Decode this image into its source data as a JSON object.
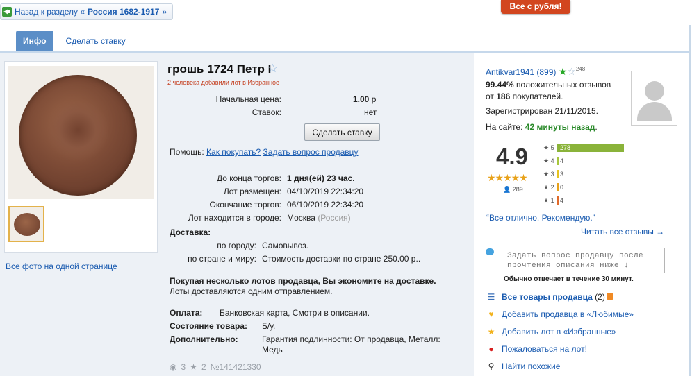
{
  "topbar": {
    "back_prefix": "Назад к разделу «",
    "back_section": "Россия 1682-1917",
    "back_suffix": "»",
    "promo": "Все с рубля!"
  },
  "tabs": [
    {
      "label": "Инфо"
    },
    {
      "label": "Сделать ставку"
    }
  ],
  "gallery": {
    "all_photos_link": "Все фото на одной странице"
  },
  "lot": {
    "title": "грошь 1724 Петр I",
    "fav_note": "2 человека добавили лот в Избранное",
    "start_price_label": "Начальная цена:",
    "start_price_value": "1.00",
    "currency": "р",
    "bids_label": "Ставок:",
    "bids_value": "нет",
    "bid_button": "Сделать ставку",
    "help_label": "Помощь:",
    "help_link_1": "Как покупать?",
    "help_link_2": "Задать вопрос продавцу",
    "end_in_label": "До конца торгов:",
    "end_in_value": "1 дня(ей) 23 час.",
    "placed_label": "Лот размещен:",
    "placed_value": "04/10/2019 22:34:20",
    "ends_label": "Окончание торгов:",
    "ends_value": "06/10/2019 22:34:20",
    "city_label": "Лот находится в городе:",
    "city_value": "Москва",
    "country_value": "(Россия)",
    "delivery_label": "Доставка:",
    "delivery_city_label": "по городу:",
    "delivery_city_value": "Самовывоз.",
    "delivery_world_label": "по стране и миру:",
    "delivery_world_value": "Стоимость доставки по стране 250.00 р..",
    "save_note_bold": "Покупая несколько лотов продавца, Вы экономите на доставке.",
    "save_note": "Лоты доставляются одним отправлением.",
    "payment_label": "Оплата:",
    "payment_value": "Банковская карта, Смотри в описании.",
    "condition_label": "Состояние товара:",
    "condition_value": "Б/у.",
    "extra_label": "Дополнительно:",
    "extra_value_1": "Гарантия подлинности: От продавца, Металл:",
    "extra_value_2": "Медь",
    "views": "3",
    "favs": "2",
    "lot_number": "№141421330"
  },
  "seller": {
    "name": "Antikvar1941",
    "rating_count": "(899)",
    "sup_count": "248",
    "positive_pct": "99.44%",
    "positive_text": "положительных отзывов",
    "from_label": "от",
    "buyers_count": "186",
    "buyers_label": "покупателей.",
    "registered": "Зарегистрирован 21/11/2015.",
    "online_label": "На сайте:",
    "online_value": "42 минуты назад",
    "score": "4.9",
    "reviews_total": "289",
    "quote": "“Все отлично. Рекомендую.”",
    "read_all": "Читать все отзывы →",
    "ask_placeholder": "Задать вопрос продавцу после прочтения описания ниже ↓",
    "reply_note": "Обычно отвечает в течение 30 минут.",
    "all_goods": "Все товары продавца",
    "all_goods_count": "(2)",
    "add_seller": "Добавить продавца в «Любимые»",
    "add_lot": "Добавить лот в «Избранные»",
    "complain": "Пожаловаться на лот!",
    "similar": "Найти похожие"
  },
  "rating_bars": [
    {
      "stars": "5",
      "count": "278",
      "share": 1.0,
      "color": "#8ab33a"
    },
    {
      "stars": "4",
      "count": "4",
      "share": 0.0,
      "color": "#a7c63c"
    },
    {
      "stars": "3",
      "count": "3",
      "share": 0.0,
      "color": "#e5c21f"
    },
    {
      "stars": "2",
      "count": "0",
      "share": 0.0,
      "color": "#e8a21a"
    },
    {
      "stars": "1",
      "count": "4",
      "share": 0.0,
      "color": "#e06a2a"
    }
  ],
  "colors": {
    "accent": "#5b8ec7",
    "link": "#1a5bb0",
    "promo": "#d2461f",
    "online": "#2a8a2a",
    "alert": "#c43c1c"
  }
}
